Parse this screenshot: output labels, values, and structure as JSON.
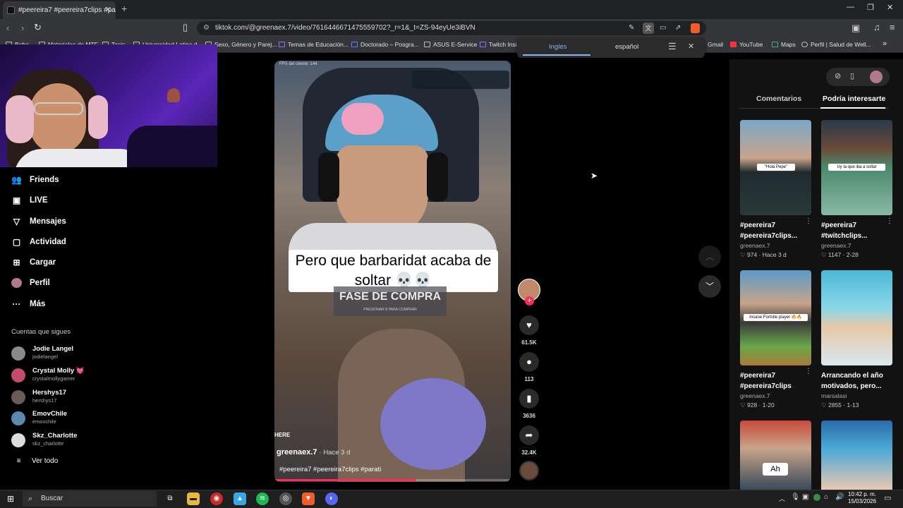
{
  "browser": {
    "tab_title": "#peereira7 #peereira7clips #pa",
    "url": "tiktok.com/@greenaex.7/video/7616446671475559702?_r=1&_t=ZS-94eyUe3iBVN",
    "bookmarks": [
      "Bebe",
      "Materiales de MTF",
      "Tesis",
      "Universidad Latina d...",
      "Sexo, Género y Parej...",
      "Temas de Educación...",
      "Doctorado – Posgra...",
      "ASUS E-Service",
      "Twitch Insi",
      "Gmail",
      "YouTube",
      "Maps",
      "Perfil | Salud de Well..."
    ]
  },
  "translate": {
    "source": "Inglés",
    "target": "español"
  },
  "sidebar": {
    "items": [
      {
        "label": "Friends",
        "icon": "friends-icon"
      },
      {
        "label": "LIVE",
        "icon": "live-icon"
      },
      {
        "label": "Mensajes",
        "icon": "messages-icon"
      },
      {
        "label": "Actividad",
        "icon": "activity-icon"
      },
      {
        "label": "Cargar",
        "icon": "upload-icon"
      },
      {
        "label": "Perfil",
        "icon": "profile-icon"
      },
      {
        "label": "Más",
        "icon": "more-icon"
      }
    ],
    "following_title": "Cuentas que sigues",
    "following": [
      {
        "name": "Jodie Langel",
        "handle": "jodielangel"
      },
      {
        "name": "Crystal Molly 💓",
        "handle": "crystalmollygamer"
      },
      {
        "name": "Hershys17",
        "handle": "hershys17"
      },
      {
        "name": "EmovChile",
        "handle": "emovchile"
      },
      {
        "name": "Skz_Charlotte",
        "handle": "skz_charlotte"
      }
    ],
    "see_all": "Ver todo"
  },
  "video": {
    "caption": "Pero que barbaridat acaba de soltar 💀💀",
    "overlay_text": "FASE DE COMPRA",
    "author": "greenaex.7",
    "time_ago": "Hace 3 d",
    "hashtags": "#peereira7 #peereira7clips #parati",
    "fps_label": "FPS del cliente: 144",
    "likes": "61.5K",
    "comments": "113",
    "saves": "3636",
    "shares": "32.4K",
    "progress": 0.6
  },
  "right_panel": {
    "tabs": [
      "Comentarios",
      "Podría interesarte"
    ],
    "cards": [
      {
        "title": "#peereira7 #peereira7clips...",
        "author": "greenaex.7",
        "likes": "974",
        "date": "Hace 3 d"
      },
      {
        "title": "#peereira7 #twitchclips...",
        "author": "greenaex.7",
        "likes": "1147",
        "date": "2-28"
      },
      {
        "title": "#peereira7 #peereira7clips",
        "author": "greenaex.7",
        "likes": "928",
        "date": "1-20"
      },
      {
        "title": "Arrancando el año motivados, pero...",
        "author": "marsalasi",
        "likes": "2855",
        "date": "1-13"
      }
    ]
  },
  "taskbar": {
    "search_placeholder": "Buscar",
    "time": "10:42 p. m.",
    "date": "15/03/2026"
  }
}
